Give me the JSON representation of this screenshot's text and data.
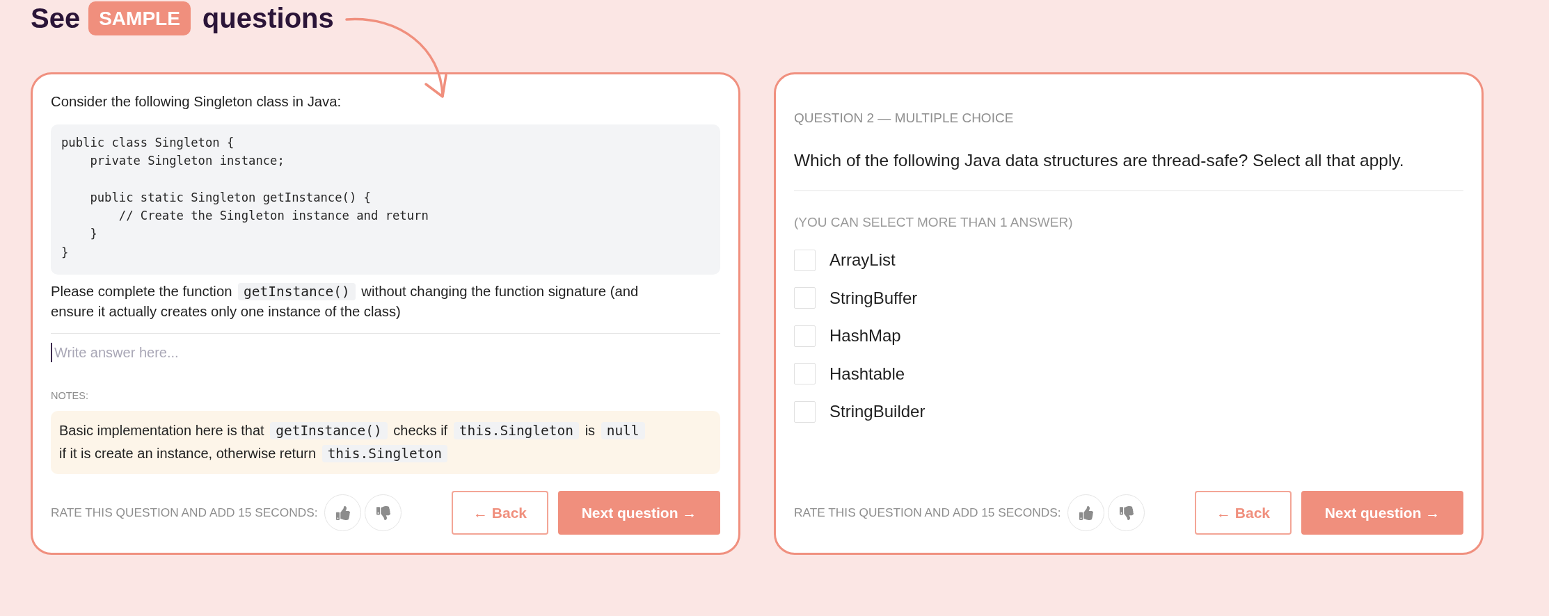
{
  "heading": {
    "before": "See",
    "tag": "SAMPLE",
    "after": "questions"
  },
  "cards": [
    {
      "kind": "code",
      "intro": "Consider the following Singleton class in Java:",
      "code": "public class Singleton {\n    private Singleton instance;\n\n    public static Singleton getInstance() {\n        // Create the Singleton instance and return\n    }\n}",
      "prompt_lines": [
        [
          {
            "kind": "text",
            "text": "Please complete the function "
          },
          {
            "kind": "code",
            "text": "getInstance()"
          },
          {
            "kind": "text",
            "text": " without changing the function signature (and"
          }
        ],
        [
          {
            "kind": "text",
            "text": "ensure it actually creates only one instance of the class)"
          }
        ]
      ],
      "answer": {
        "placeholder": "Write answer here...",
        "focused": true
      },
      "notes_label": "NOTES:",
      "notes_lines": [
        [
          {
            "kind": "text",
            "text": "Basic implementation here is that "
          },
          {
            "kind": "code",
            "text": "getInstance()"
          },
          {
            "kind": "text",
            "text": " checks if "
          },
          {
            "kind": "code",
            "text": "this.Singleton"
          },
          {
            "kind": "text",
            "text": " is "
          },
          {
            "kind": "code",
            "text": "null"
          }
        ],
        [
          {
            "kind": "text",
            "text": "if it is create an instance, otherwise return "
          },
          {
            "kind": "code",
            "text": "this.Singleton"
          }
        ]
      ],
      "rating_label": "RATE THIS QUESTION AND ADD 15 SECONDS:",
      "buttons": [
        {
          "kind": "back",
          "label": "← Back"
        },
        {
          "kind": "next",
          "label": "Next question →"
        }
      ]
    },
    {
      "kind": "choice",
      "eyebrow": "QUESTION 2 — MULTIPLE CHOICE",
      "question": "Which of the following Java data structures are thread-safe? Select all that apply.",
      "hint": "(YOU CAN SELECT MORE THAN 1 ANSWER)",
      "options": [
        {
          "label": "ArrayList",
          "checked": false
        },
        {
          "label": "StringBuffer",
          "checked": false
        },
        {
          "label": "HashMap",
          "checked": false
        },
        {
          "label": "Hashtable",
          "checked": false
        },
        {
          "label": "StringBuilder",
          "checked": false
        }
      ],
      "rating_label": "RATE THIS QUESTION AND ADD 15 SECONDS:",
      "buttons": [
        {
          "kind": "back",
          "label": "← Back"
        },
        {
          "kind": "next",
          "label": "Next question →"
        }
      ]
    }
  ]
}
